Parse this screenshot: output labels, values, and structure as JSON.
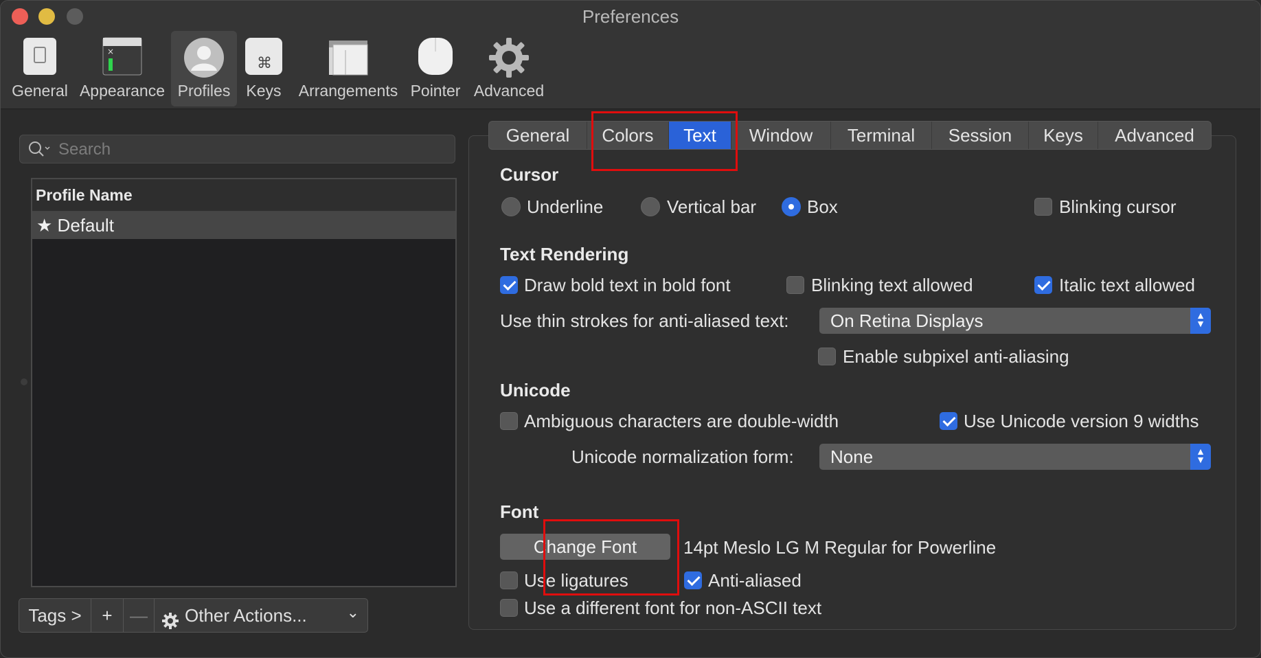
{
  "window": {
    "title": "Preferences"
  },
  "toolbar": {
    "items": [
      {
        "label": "General",
        "icon": "general-icon"
      },
      {
        "label": "Appearance",
        "icon": "appearance-icon"
      },
      {
        "label": "Profiles",
        "icon": "profiles-icon"
      },
      {
        "label": "Keys",
        "icon": "keys-icon"
      },
      {
        "label": "Arrangements",
        "icon": "arrangements-icon"
      },
      {
        "label": "Pointer",
        "icon": "pointer-icon"
      },
      {
        "label": "Advanced",
        "icon": "gear-icon"
      }
    ],
    "active": "Profiles"
  },
  "left": {
    "search_placeholder": "Search",
    "table_header": "Profile Name",
    "profiles": [
      {
        "name": "Default",
        "icon": "star-icon"
      }
    ],
    "bottom": {
      "tags": "Tags >",
      "add": "+",
      "remove": "—",
      "other_actions": "Other Actions...",
      "chevron": "⌄"
    }
  },
  "tabs": {
    "items": [
      "General",
      "Colors",
      "Text",
      "Window",
      "Terminal",
      "Session",
      "Keys",
      "Advanced"
    ],
    "active": "Text"
  },
  "cursor": {
    "heading": "Cursor",
    "underline": "Underline",
    "vertical_bar": "Vertical bar",
    "box": "Box",
    "blinking": "Blinking cursor",
    "selected": "Box"
  },
  "text_rendering": {
    "heading": "Text Rendering",
    "bold": "Draw bold text in bold font",
    "blinking_text": "Blinking text allowed",
    "italic": "Italic text allowed",
    "thin_strokes_label": "Use thin strokes for anti-aliased text:",
    "thin_strokes_value": "On Retina Displays",
    "subpixel": "Enable subpixel anti-aliasing"
  },
  "unicode": {
    "heading": "Unicode",
    "ambiguous": "Ambiguous characters are double-width",
    "version9": "Use Unicode version 9 widths",
    "normalization_label": "Unicode normalization form:",
    "normalization_value": "None"
  },
  "font": {
    "heading": "Font",
    "change_button": "Change Font",
    "current": "14pt Meslo LG M Regular for Powerline",
    "ligatures": "Use ligatures",
    "antialiased": "Anti-aliased",
    "non_ascii": "Use a different font for non-ASCII text"
  },
  "colors": {
    "accent": "#2f6ce0",
    "highlight": "#e00d0d"
  }
}
